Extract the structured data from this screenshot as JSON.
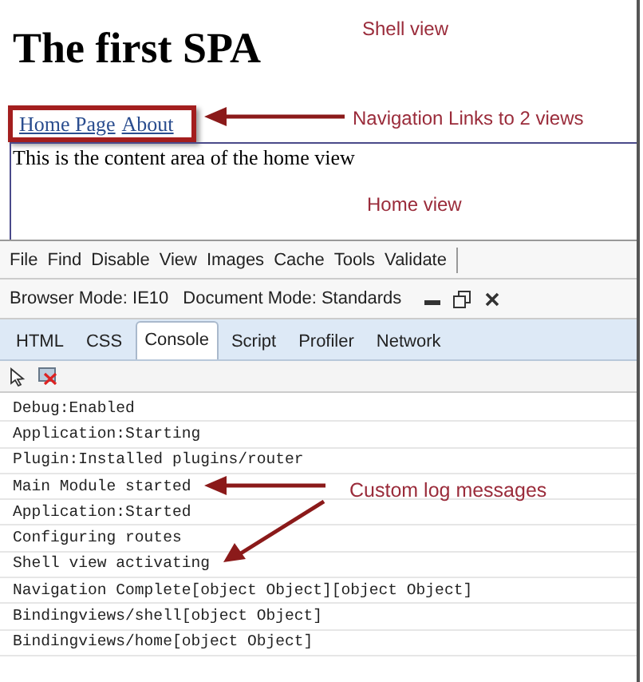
{
  "page": {
    "heading": "The first SPA",
    "nav_links": [
      "Home Page",
      "About"
    ],
    "content": "This is the content area of the home view"
  },
  "devtools": {
    "menu": [
      "File",
      "Find",
      "Disable",
      "View",
      "Images",
      "Cache",
      "Tools",
      "Validate"
    ],
    "mode_bar": {
      "browser_mode": "Browser Mode: IE10",
      "document_mode": "Document Mode: Standards"
    },
    "tabs": [
      {
        "label": "HTML",
        "selected": false
      },
      {
        "label": "CSS",
        "selected": false
      },
      {
        "label": "Console",
        "selected": true
      },
      {
        "label": "Script",
        "selected": false
      },
      {
        "label": "Profiler",
        "selected": false
      },
      {
        "label": "Network",
        "selected": false
      }
    ],
    "console_lines": [
      "Debug:Enabled",
      "Application:Starting",
      "Plugin:Installed plugins/router",
      "Main Module started",
      "Application:Started",
      "Configuring routes",
      "Shell view activating",
      "Navigation Complete[object Object][object Object]",
      "Bindingviews/shell[object Object]",
      "Bindingviews/home[object Object]"
    ]
  },
  "annotations": {
    "shell": "Shell view",
    "nav": "Navigation Links to 2 views",
    "home": "Home view",
    "log": "Custom log messages"
  }
}
